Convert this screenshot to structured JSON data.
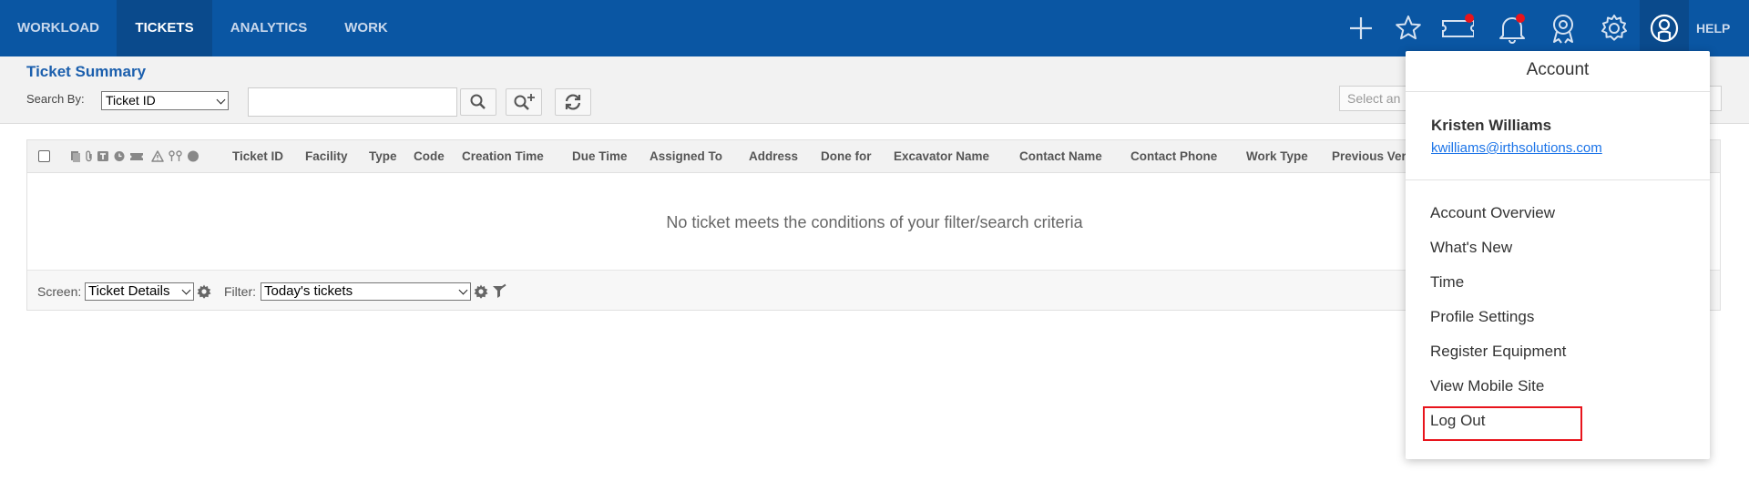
{
  "nav": {
    "items": [
      {
        "label": "WORKLOAD",
        "active": false
      },
      {
        "label": "TICKETS",
        "active": true
      },
      {
        "label": "ANALYTICS",
        "active": false
      },
      {
        "label": "WORK",
        "active": false
      }
    ],
    "icons": [
      "plus-icon",
      "star-icon",
      "ticket-icon",
      "bell-icon",
      "award-icon",
      "gear-icon",
      "user-icon"
    ],
    "help_label": "HELP"
  },
  "subheader": {
    "title": "Ticket Summary",
    "search_by_label": "Search By:",
    "search_by_value": "Ticket ID",
    "search_input_value": "",
    "right_select_placeholder": "Select an"
  },
  "table": {
    "header_icons": [
      "document-icon",
      "paperclip-icon",
      "text-icon",
      "clock-icon",
      "ticket-icon",
      "warning-icon",
      "keys-icon",
      "circle-icon"
    ],
    "columns": [
      "Ticket ID",
      "Facility",
      "Type",
      "Code",
      "Creation Time",
      "Due Time",
      "Assigned To",
      "Address",
      "Done for",
      "Excavator Name",
      "Contact Name",
      "Contact Phone",
      "Work Type",
      "Previous Ver"
    ],
    "empty_message": "No ticket meets the conditions of your filter/search criteria"
  },
  "footer": {
    "screen_label": "Screen:",
    "screen_value": "Ticket Details",
    "filter_label": "Filter:",
    "filter_value": "Today's tickets"
  },
  "account_menu": {
    "title": "Account",
    "user_name": "Kristen Williams",
    "user_email": "kwilliams@irthsolutions.com",
    "items": [
      "Account Overview",
      "What's New",
      "Time",
      "Profile Settings",
      "Register Equipment",
      "View Mobile Site",
      "Log Out"
    ],
    "highlighted_item": "Log Out"
  },
  "colors": {
    "topbar": "#0a56a3",
    "active_nav": "#0a4a8c",
    "title_blue": "#1b5fad",
    "notification": "#e8141c",
    "highlight_border": "#e8141c"
  }
}
